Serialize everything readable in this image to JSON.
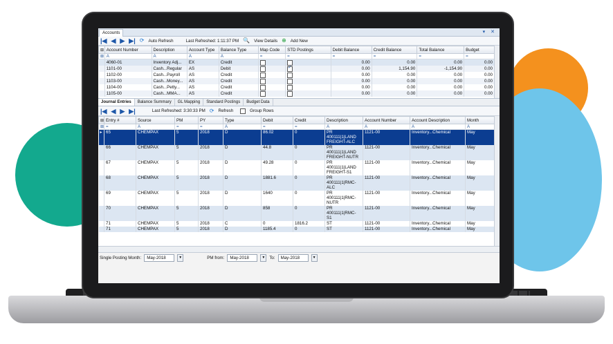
{
  "window": {
    "tab": "Accounts",
    "controls": "▾ ✕"
  },
  "top_toolbar": {
    "auto_refresh": "Auto Refresh",
    "last_refreshed": "Last Refreshed: 1:11:37 PM",
    "view_details": "View Details",
    "add_new": "Add New"
  },
  "accounts_grid": {
    "headers": [
      "Account Number",
      "Description",
      "Account Type",
      "Balance Type",
      "Map Code",
      "STD Postings",
      "Debit Balance",
      "Credit Balance",
      "Total Balance",
      "Budget"
    ],
    "rows": [
      {
        "account": "4060-01",
        "desc": "Inventory Adj...",
        "type": "EX",
        "balance_type": "Credit",
        "std": false,
        "debit": "0.00",
        "credit": "0.00",
        "total": "0.00",
        "budget": "0.00"
      },
      {
        "account": "1101-00",
        "desc": "Cash...Regular",
        "type": "AS",
        "balance_type": "Debit",
        "std": true,
        "debit": "0.00",
        "credit": "1,154.90",
        "total": "-1,154.90",
        "budget": "0.00"
      },
      {
        "account": "1102-00",
        "desc": "Cash...Payroll",
        "type": "AS",
        "balance_type": "Credit",
        "std": false,
        "debit": "0.00",
        "credit": "0.00",
        "total": "0.00",
        "budget": "0.00"
      },
      {
        "account": "1103-00",
        "desc": "Cash...Money...",
        "type": "AS",
        "balance_type": "Credit",
        "std": false,
        "debit": "0.00",
        "credit": "0.00",
        "total": "0.00",
        "budget": "0.00"
      },
      {
        "account": "1104-00",
        "desc": "Cash...Petty...",
        "type": "AS",
        "balance_type": "Credit",
        "std": false,
        "debit": "0.00",
        "credit": "0.00",
        "total": "0.00",
        "budget": "0.00"
      },
      {
        "account": "1105-00",
        "desc": "Cash...MMA...",
        "type": "AS",
        "balance_type": "Credit",
        "std": false,
        "debit": "0.00",
        "credit": "0.00",
        "total": "0.00",
        "budget": "0.00"
      }
    ]
  },
  "detail_tabs": [
    "Journal Entries",
    "Balance Summary",
    "GL Mapping",
    "Standard Postings",
    "Budget Data"
  ],
  "bottom_toolbar": {
    "last_refreshed": "Last Refreshed: 3:30:33 PM",
    "refresh": "Refresh",
    "group_rows": "Group Rows"
  },
  "journal_grid": {
    "headers": [
      "Entry #",
      "Source",
      "PM",
      "PY",
      "Type",
      "Debit",
      "Credit",
      "Description",
      "Account Number",
      "Account Description",
      "Month"
    ],
    "rows": [
      {
        "entry": "65",
        "source": "CHEMPAX",
        "pm": "5",
        "py": "2018",
        "type": "D",
        "debit": "86.02",
        "credit": "0",
        "desc": "PR 400111|1|LAND FREIGHT-ALC",
        "acct": "1121-00",
        "acct_desc": "Inventory...Chemical",
        "month": "May"
      },
      {
        "entry": "66",
        "source": "CHEMPAX",
        "pm": "5",
        "py": "2018",
        "type": "D",
        "debit": "44.8",
        "credit": "0",
        "desc": "PR 400111|1|LAND FREIGHT-NUTR",
        "acct": "1121-00",
        "acct_desc": "Inventory...Chemical",
        "month": "May"
      },
      {
        "entry": "67",
        "source": "CHEMPAX",
        "pm": "5",
        "py": "2018",
        "type": "D",
        "debit": "49.28",
        "credit": "0",
        "desc": "PR 400111|1|LAND FREIGHT-S1",
        "acct": "1121-00",
        "acct_desc": "Inventory...Chemical",
        "month": "May"
      },
      {
        "entry": "68",
        "source": "CHEMPAX",
        "pm": "5",
        "py": "2018",
        "type": "D",
        "debit": "1881.6",
        "credit": "0",
        "desc": "PR 400111|1|RMC-ALC",
        "acct": "1121-00",
        "acct_desc": "Inventory...Chemical",
        "month": "May"
      },
      {
        "entry": "69",
        "source": "CHEMPAX",
        "pm": "5",
        "py": "2018",
        "type": "D",
        "debit": "1640",
        "credit": "0",
        "desc": "PR 400111|1|RMC-NUTR",
        "acct": "1121-00",
        "acct_desc": "Inventory...Chemical",
        "month": "May"
      },
      {
        "entry": "70",
        "source": "CHEMPAX",
        "pm": "5",
        "py": "2018",
        "type": "D",
        "debit": "858",
        "credit": "0",
        "desc": "PR 400111|1|RMC-S1",
        "acct": "1121-00",
        "acct_desc": "Inventory...Chemical",
        "month": "May"
      },
      {
        "entry": "71",
        "source": "CHEMPAX",
        "pm": "5",
        "py": "2018",
        "type": "C",
        "debit": "0",
        "credit": "1816.2",
        "desc": "ST",
        "acct": "1121-00",
        "acct_desc": "Inventory...Chemical",
        "month": "May"
      },
      {
        "entry": "71",
        "source": "CHEMPAX",
        "pm": "5",
        "py": "2018",
        "type": "D",
        "debit": "1185.4",
        "credit": "0",
        "desc": "ST",
        "acct": "1121-00",
        "acct_desc": "Inventory...Chemical",
        "month": "May"
      }
    ]
  },
  "footer": {
    "single_posting_label": "Single Posting Month:",
    "single_posting_value": "May-2018",
    "pm_from_label": "PM from:",
    "pm_from_value": "May-2018",
    "to_label": "To:",
    "to_value": "May-2018"
  },
  "colors": {
    "selected_row": "#0b3d91",
    "accent": "#1d57a8",
    "teal": "#13a98e",
    "orange": "#f4911e",
    "sky": "#6ec5ea"
  }
}
